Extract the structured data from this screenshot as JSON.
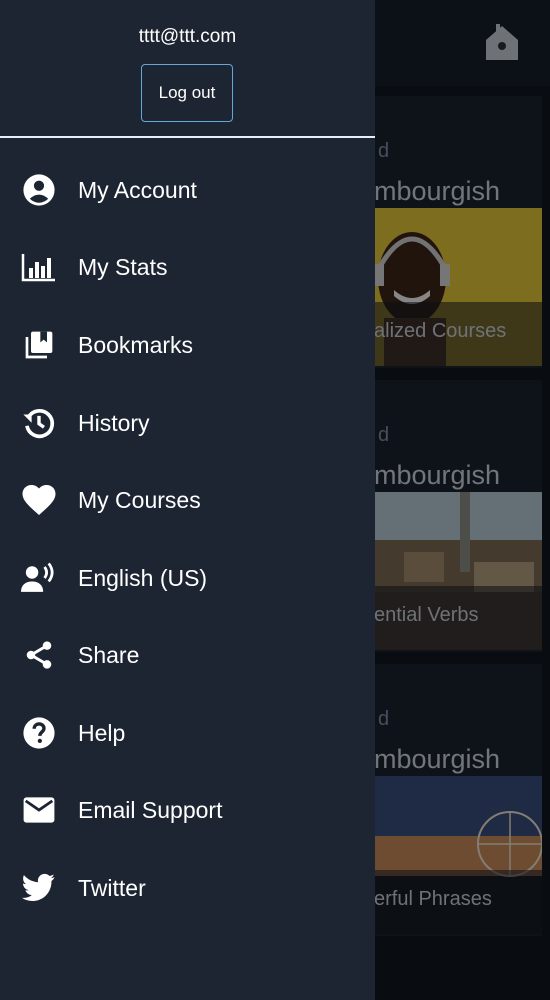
{
  "drawer": {
    "email": "tttt@ttt.com",
    "logout_label": "Log out",
    "items": [
      {
        "label": "My Account",
        "icon": "account-circle-icon"
      },
      {
        "label": "My Stats",
        "icon": "stats-bar-chart-icon"
      },
      {
        "label": "Bookmarks",
        "icon": "bookmarks-icon"
      },
      {
        "label": "History",
        "icon": "history-icon"
      },
      {
        "label": "My Courses",
        "icon": "heart-icon"
      },
      {
        "label": "English (US)",
        "icon": "voice-language-icon"
      },
      {
        "label": "Share",
        "icon": "share-icon"
      },
      {
        "label": "Help",
        "icon": "help-icon"
      },
      {
        "label": "Email Support",
        "icon": "email-icon"
      },
      {
        "label": "Twitter",
        "icon": "twitter-icon"
      }
    ]
  },
  "background": {
    "cards": [
      {
        "small": "d",
        "title": "mbourgish",
        "caption": "alized Courses"
      },
      {
        "small": "d",
        "title": "mbourgish",
        "caption": "ential Verbs"
      },
      {
        "small": "d",
        "title": "mbourgish",
        "caption": "erful Phrases"
      }
    ]
  },
  "colors": {
    "drawer_bg": "#1d2532",
    "accent_border": "#62a9d6",
    "text": "#ffffff"
  }
}
